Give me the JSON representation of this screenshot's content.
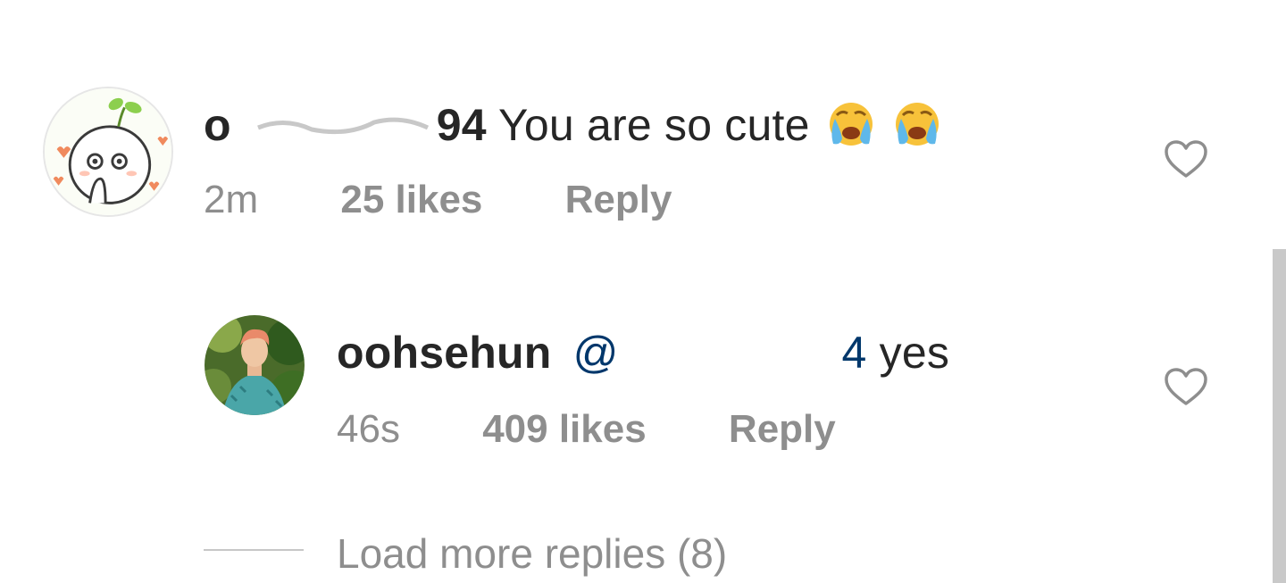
{
  "comment": {
    "username_visible_start": "o",
    "username_visible_end": "94",
    "text": "You are so cute",
    "emojis": [
      "loudly-crying-face",
      "loudly-crying-face"
    ],
    "time": "2m",
    "likes": "25 likes",
    "reply_label": "Reply"
  },
  "reply": {
    "username": "oohsehun",
    "mention_visible_start": "@",
    "mention_visible_end": "4",
    "text": "yes",
    "time": "46s",
    "likes": "409 likes",
    "reply_label": "Reply"
  },
  "load_more": {
    "label": "Load more replies (8)"
  },
  "colors": {
    "text_primary": "#262626",
    "text_secondary": "#8e8e8e",
    "mention": "#00376b",
    "heart_outline": "#8e8e8e"
  },
  "icons": {
    "heart": "heart-outline-icon",
    "emoji": "loudly-crying-face-emoji"
  }
}
